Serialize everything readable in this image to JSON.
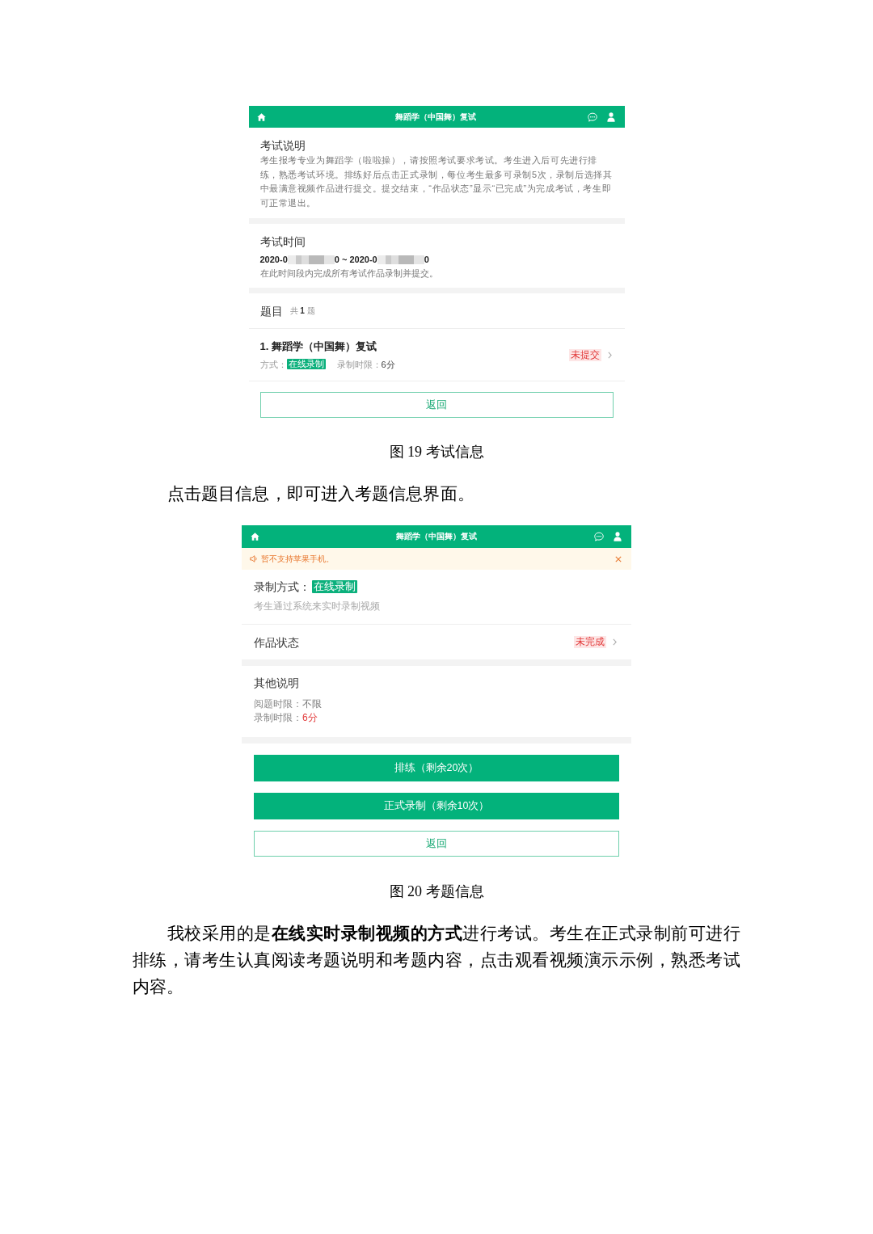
{
  "document": [
    {
      "kind": "exam_screen",
      "header": {
        "title": "舞蹈学（中国舞）复试"
      },
      "description": {
        "title": "考试说明",
        "body": "考生报考专业为舞蹈学（啦啦操），请按照考试要求考试。考生进入后可先进行排练，熟悉考试环境。排练好后点击正式录制，每位考生最多可录制5次，录制后选择其中最满意视频作品进行提交。提交结束，“作品状态”显示“已完成”为完成考试，考生即可正常退出。"
      },
      "time": {
        "title": "考试时间",
        "range": [
          {
            "kind": "text",
            "text": "2020-0"
          },
          {
            "kind": "redacted"
          },
          {
            "kind": "text",
            "text": "0 ~ 2020-0"
          },
          {
            "kind": "redacted"
          },
          {
            "kind": "text",
            "text": "0"
          }
        ],
        "note": "在此时间段内完成所有考试作品录制并提交。"
      },
      "questions": {
        "title": "题目",
        "count": "共 **1** 题",
        "items": [
          {
            "title": "1. 舞蹈学（中国舞）复试",
            "method_label": "方式：",
            "method": "在线录制",
            "limit_label": "录制时限：",
            "limit": "6分",
            "status": "未提交"
          }
        ]
      },
      "back_button": "返回"
    },
    {
      "kind": "caption",
      "text": "图 19 考试信息"
    },
    {
      "kind": "paragraph",
      "text": "点击题目信息，即可进入考题信息界面。"
    },
    {
      "kind": "question_screen",
      "header": {
        "title": "舞蹈学（中国舞）复试"
      },
      "notice": {
        "text": "暂不支持苹果手机。"
      },
      "method": {
        "label": "录制方式：",
        "value": "在线录制",
        "note": "考生通过系统来实时录制视频"
      },
      "status": {
        "label": "作品状态",
        "value": "未完成"
      },
      "other": {
        "title": "其他说明",
        "rows": [
          {
            "label": "阅题时限：",
            "value": "不限",
            "highlighted": false
          },
          {
            "label": "录制时限：",
            "value": "6分",
            "highlighted": true
          }
        ]
      },
      "buttons": [
        {
          "kind": "primary",
          "label": "排练（剩余20次）"
        },
        {
          "kind": "primary",
          "label": "正式录制（剩余10次）"
        },
        {
          "kind": "outline",
          "label": "返回"
        }
      ]
    },
    {
      "kind": "caption",
      "text": "图 20 考题信息"
    },
    {
      "kind": "paragraph",
      "text": "我校采用的是**在线实时录制视频的方式**进行考试。考生在正式录制前可进行排练，请考生认真阅读考题说明和考题内容，点击观看视频演示示例，熟悉考试内容。"
    }
  ]
}
